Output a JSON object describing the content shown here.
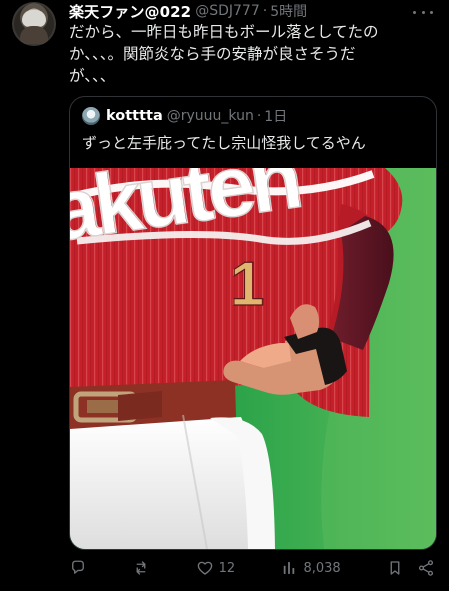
{
  "tweet": {
    "display_name": "楽天ファン@022",
    "handle": "@SDJ777",
    "separator": "·",
    "time": "5時間",
    "text": "だから、一昨日も昨日もボール落としてたの\nか、、、。関節炎なら手の安静が良さそうだ\nが、、、"
  },
  "quote": {
    "display_name": "kotttta",
    "handle": "@ryuuu_kun",
    "separator": "·",
    "time": "1日",
    "text": "ずっと左手庇ってたし宗山怪我してるやん",
    "photo": {
      "jersey_text": "akuten",
      "jersey_number": "1"
    }
  },
  "actions": {
    "likes": "12",
    "views": "8,038"
  },
  "colors": {
    "background": "#000000",
    "primary_text": "#e7e9ea",
    "secondary_text": "#71767b",
    "border": "#2f3336",
    "jersey_red": "#c4242c",
    "field_green": "#2b9f48"
  }
}
